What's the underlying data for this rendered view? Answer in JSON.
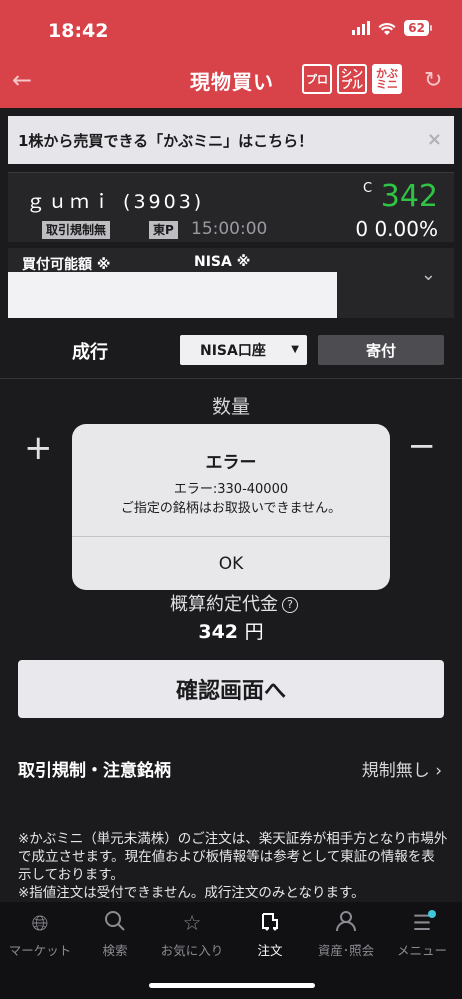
{
  "status_bar": {
    "time": "18:42",
    "battery": "62"
  },
  "header": {
    "title": "現物買い",
    "mode_pro": "プロ",
    "mode_simple_1": "シン",
    "mode_simple_2": "プル",
    "mode_kabu_1": "かぶ",
    "mode_kabu_2": "ミニ"
  },
  "banner": {
    "text": "1株から売買できる「かぶミニ」はこちら！",
    "close": "×"
  },
  "stock": {
    "name": "ｇｕｍｉ (3903)",
    "price_mark": "C",
    "price": "342",
    "regulation_tag": "取引規制無",
    "market_tag": "東P",
    "time": "15:00:00",
    "change": "0  0.00%"
  },
  "buying_power": {
    "label": "買付可能額 ※",
    "nisa_label": "NISA ※"
  },
  "order": {
    "type_label": "成行",
    "account": "NISA口座",
    "timing": "寄付"
  },
  "quantity": {
    "label": "数量",
    "plus": "+",
    "minus": "−"
  },
  "estimate": {
    "label": "概算約定代金",
    "info": "?",
    "value": "342",
    "unit": "円"
  },
  "confirm_button": "確認画面へ",
  "regulation": {
    "label": "取引規制・注意銘柄",
    "value": "規制無し ›"
  },
  "notes": [
    "※かぶミニ（単元未満株）のご注文は、楽天証券が相手方となり市場外で成立させます。現在値および板情報等は参考として東証の情報を表示しております。",
    "※指値注文は受付できません。成行注文のみとなります。"
  ],
  "dialog": {
    "title": "エラー",
    "code": "エラー:330-40000",
    "message": "ご指定の銘柄はお取扱いできません。",
    "ok": "OK"
  },
  "bottom_nav": [
    {
      "label": "マーケット",
      "icon": "globe-icon"
    },
    {
      "label": "検索",
      "icon": "search-icon"
    },
    {
      "label": "お気に入り",
      "icon": "star-icon"
    },
    {
      "label": "注文",
      "icon": "order-icon"
    },
    {
      "label": "資産･照会",
      "icon": "person-icon"
    },
    {
      "label": "メニュー",
      "icon": "menu-icon"
    }
  ],
  "colors": {
    "brand_red": "#d8434a",
    "price_green": "#2fc443",
    "badge_cyan": "#3ec6dc"
  }
}
